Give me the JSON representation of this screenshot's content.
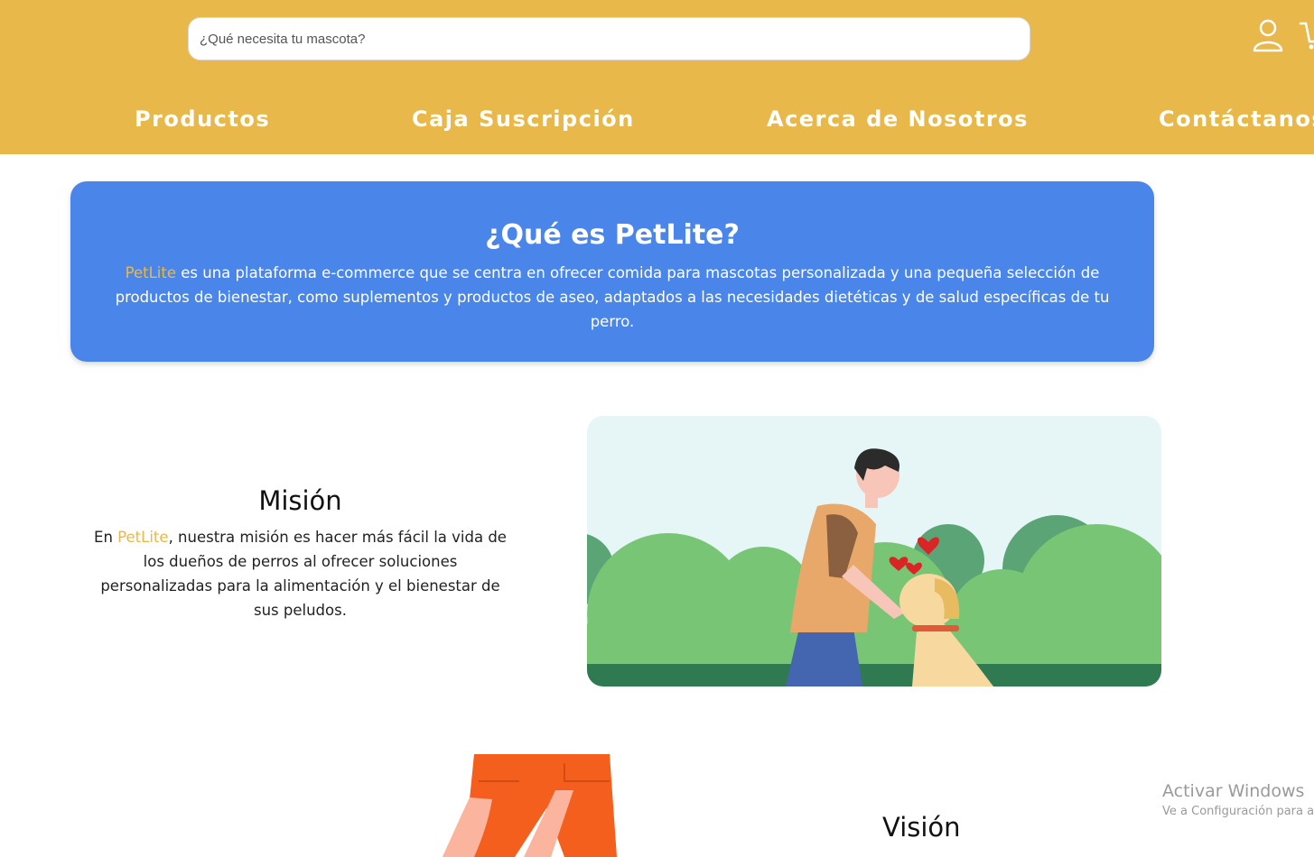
{
  "header": {
    "search_placeholder": "¿Qué necesita tu mascota?",
    "nav": [
      "Productos",
      "Caja Suscripción",
      "Acerca de Nosotros",
      "Contáctanos"
    ],
    "icons": [
      "user-icon",
      "cart-icon"
    ],
    "background": "#e9b84a"
  },
  "intro": {
    "title": "¿Qué es PetLite?",
    "brand": "PetLite",
    "text": " es una plataforma e-commerce que se centra en ofrecer comida para mascotas personalizada y una pequeña selección de productos de bienestar, como suplementos y productos de aseo, adaptados a las necesidades dietéticas y de salud específicas de tu perro.",
    "background": "#4a86ea"
  },
  "mission": {
    "title": "Misión",
    "text_before": "En ",
    "brand": "PetLite",
    "text_after": ", nuestra misión es hacer más fácil la vida de los dueños de perros al ofrecer soluciones personalizadas para la alimentación y el bienestar de sus peludos."
  },
  "vision": {
    "title": "Visión"
  },
  "watermark": {
    "line1": "Activar Windows",
    "line2": "Ve a Configuración para activar Windows."
  },
  "colors": {
    "accent": "#e9b84a",
    "primary": "#4a86ea"
  }
}
